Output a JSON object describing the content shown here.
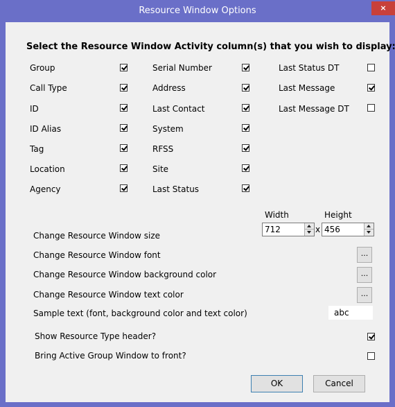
{
  "window": {
    "title": "Resource Window Options",
    "close_glyph": "×"
  },
  "heading": "Select the Resource Window Activity column(s) that you wish to display:",
  "columns": {
    "col1": [
      {
        "label": "Group",
        "checked": true
      },
      {
        "label": "Call Type",
        "checked": true
      },
      {
        "label": "ID",
        "checked": true
      },
      {
        "label": "ID Alias",
        "checked": true
      },
      {
        "label": "Tag",
        "checked": true
      },
      {
        "label": "Location",
        "checked": true
      },
      {
        "label": "Agency",
        "checked": true
      }
    ],
    "col2": [
      {
        "label": "Serial Number",
        "checked": true
      },
      {
        "label": "Address",
        "checked": true
      },
      {
        "label": "Last Contact",
        "checked": true
      },
      {
        "label": "System",
        "checked": true
      },
      {
        "label": "RFSS",
        "checked": true
      },
      {
        "label": "Site",
        "checked": true
      },
      {
        "label": "Last Status",
        "checked": true
      }
    ],
    "col3": [
      {
        "label": "Last Status DT",
        "checked": false
      },
      {
        "label": "Last Message",
        "checked": true
      },
      {
        "label": "Last Message DT",
        "checked": false
      }
    ]
  },
  "size": {
    "label": "Change Resource Window size",
    "width_label": "Width",
    "height_label": "Height",
    "width_value": "712",
    "height_value": "456",
    "separator": "x"
  },
  "font": {
    "label": "Change Resource Window font",
    "button": "..."
  },
  "background": {
    "label": "Change Resource Window background color",
    "button": "..."
  },
  "text_color": {
    "label": "Change Resource Window text color",
    "button": "..."
  },
  "sample": {
    "label": "Sample text (font, background color and text color)",
    "value": "abc"
  },
  "options": {
    "show_header": {
      "label": "Show Resource Type header?",
      "checked": true
    },
    "bring_front": {
      "label": "Bring Active Group Window to front?",
      "checked": false
    }
  },
  "buttons": {
    "ok": "OK",
    "cancel": "Cancel"
  }
}
